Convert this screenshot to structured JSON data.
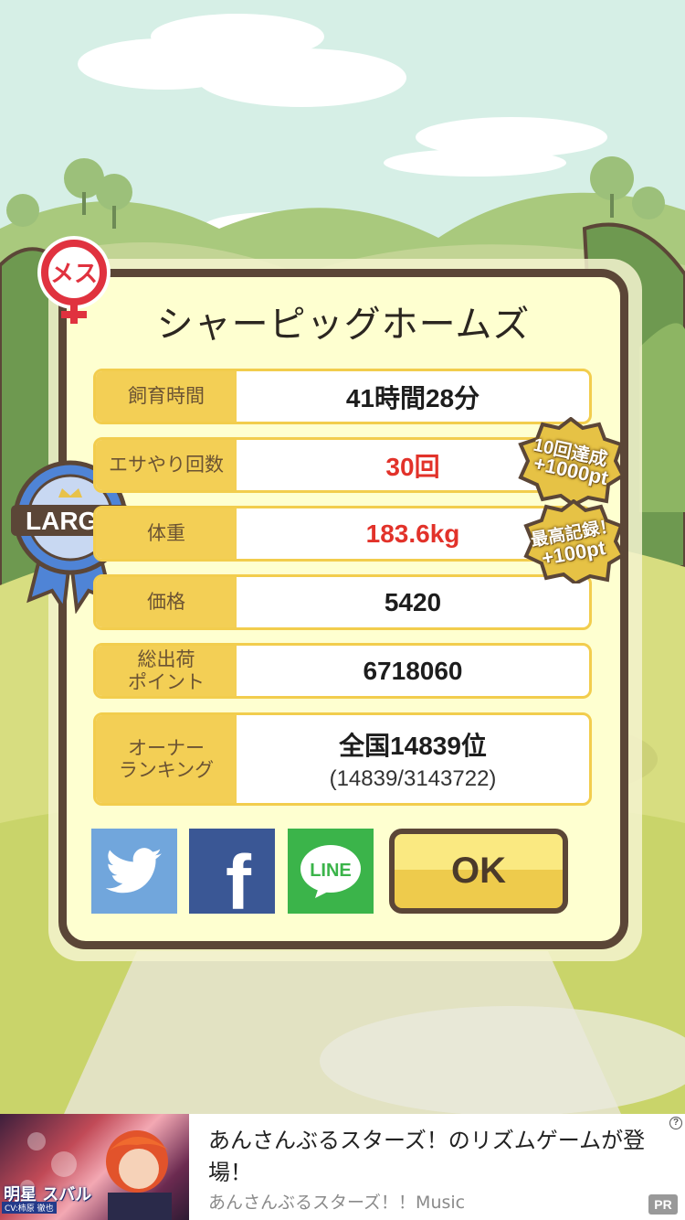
{
  "pig": {
    "name": "シャーピッグホームズ",
    "gender_symbol_text": "メス",
    "size_ribbon_text": "LARGE"
  },
  "stats": [
    {
      "label": "飼育時間",
      "value": "41時間28分",
      "highlight": false
    },
    {
      "label": "エサやり回数",
      "value": "30回",
      "highlight": true
    },
    {
      "label": "体重",
      "value": "183.6kg",
      "highlight": true
    },
    {
      "label": "価格",
      "value": "5420",
      "highlight": false
    },
    {
      "label": "総出荷\nポイント",
      "value": "6718060",
      "highlight": false
    },
    {
      "label": "オーナー\nランキング",
      "value": "全国14839位",
      "sub": "(14839/3143722)",
      "highlight": false
    }
  ],
  "bonus_badges": [
    {
      "line1": "10回達成",
      "line2": "+1000pt"
    },
    {
      "line1": "最高記録！",
      "line2": "+100pt"
    }
  ],
  "share_buttons": [
    {
      "name": "twitter",
      "icon": "twitter-bird-icon",
      "color": "#71a6dc"
    },
    {
      "name": "facebook",
      "icon": "facebook-f-icon",
      "color": "#3a5795",
      "glyph": "f"
    },
    {
      "name": "line",
      "icon": "line-icon",
      "color": "#3bb44a",
      "glyph": "LINE"
    }
  ],
  "ok_label": "OK",
  "ad": {
    "title": "あんさんぶるスターズ！のリズムゲームが登場！",
    "subtitle": "あんさんぶるスターズ！！Music",
    "thumb_caption": "明星 スバル",
    "thumb_cv": "CV:柿原 徹也",
    "info_glyph": "?",
    "pr_label": "PR"
  },
  "colors": {
    "frame": "#5b4637",
    "label_yellow": "#f3cf55",
    "highlight_red": "#e2322a",
    "card_bg": "#feffd0"
  }
}
